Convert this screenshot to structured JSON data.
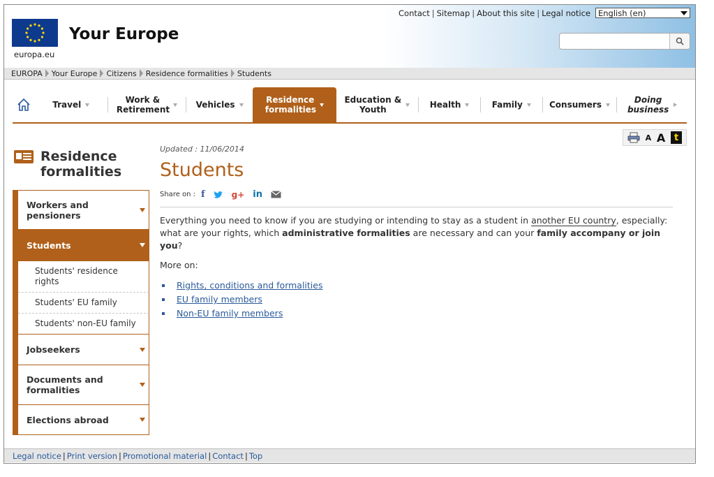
{
  "utility_links": [
    "Contact",
    "Sitemap",
    "About this site",
    "Legal notice"
  ],
  "language": "English (en)",
  "logo_caption": "europa.eu",
  "site_title": "Your Europe",
  "search": {
    "placeholder": ""
  },
  "breadcrumb": [
    "EUROPA",
    "Your Europe",
    "Citizens",
    "Residence formalities",
    "Students"
  ],
  "nav": [
    {
      "label": "Travel"
    },
    {
      "label": "Work & Retirement"
    },
    {
      "label": "Vehicles"
    },
    {
      "label": "Residence formalities",
      "active": true
    },
    {
      "label": "Education & Youth"
    },
    {
      "label": "Health"
    },
    {
      "label": "Family"
    },
    {
      "label": "Consumers"
    },
    {
      "label": "Doing business"
    }
  ],
  "tools": {
    "font_small": "A",
    "font_large": "A",
    "text_only": "t"
  },
  "sidebar": {
    "title": "Residence formalities",
    "items": [
      {
        "label": "Workers and pensioners"
      },
      {
        "label": "Students",
        "active": true
      },
      {
        "label": "Jobseekers"
      },
      {
        "label": "Documents and formalities"
      },
      {
        "label": "Elections abroad"
      }
    ],
    "subitems": [
      "Students' residence rights",
      "Students' EU family",
      "Students' non-EU family"
    ]
  },
  "main": {
    "updated": "Updated : 11/06/2014",
    "title": "Students",
    "share_label": "Share on :",
    "intro_1": "Everything you need to know if you are studying or intending to stay as a student in ",
    "intro_link": "another EU country",
    "intro_2": ", especially: what are your rights, which ",
    "intro_bold1": "administrative formalities",
    "intro_3": " are necessary and can your ",
    "intro_bold2": "family accompany or join you",
    "intro_4": "?",
    "more_on": "More on:",
    "links": [
      "Rights, conditions and formalities",
      "EU family members",
      "Non-EU family members"
    ]
  },
  "footer": [
    "Legal notice",
    "Print version",
    "Promotional material",
    "Contact",
    "Top"
  ],
  "colors": {
    "accent": "#b0601a",
    "link": "#2a5a9a",
    "eu_blue": "#0e3a8e",
    "eu_gold": "#ffd700"
  }
}
